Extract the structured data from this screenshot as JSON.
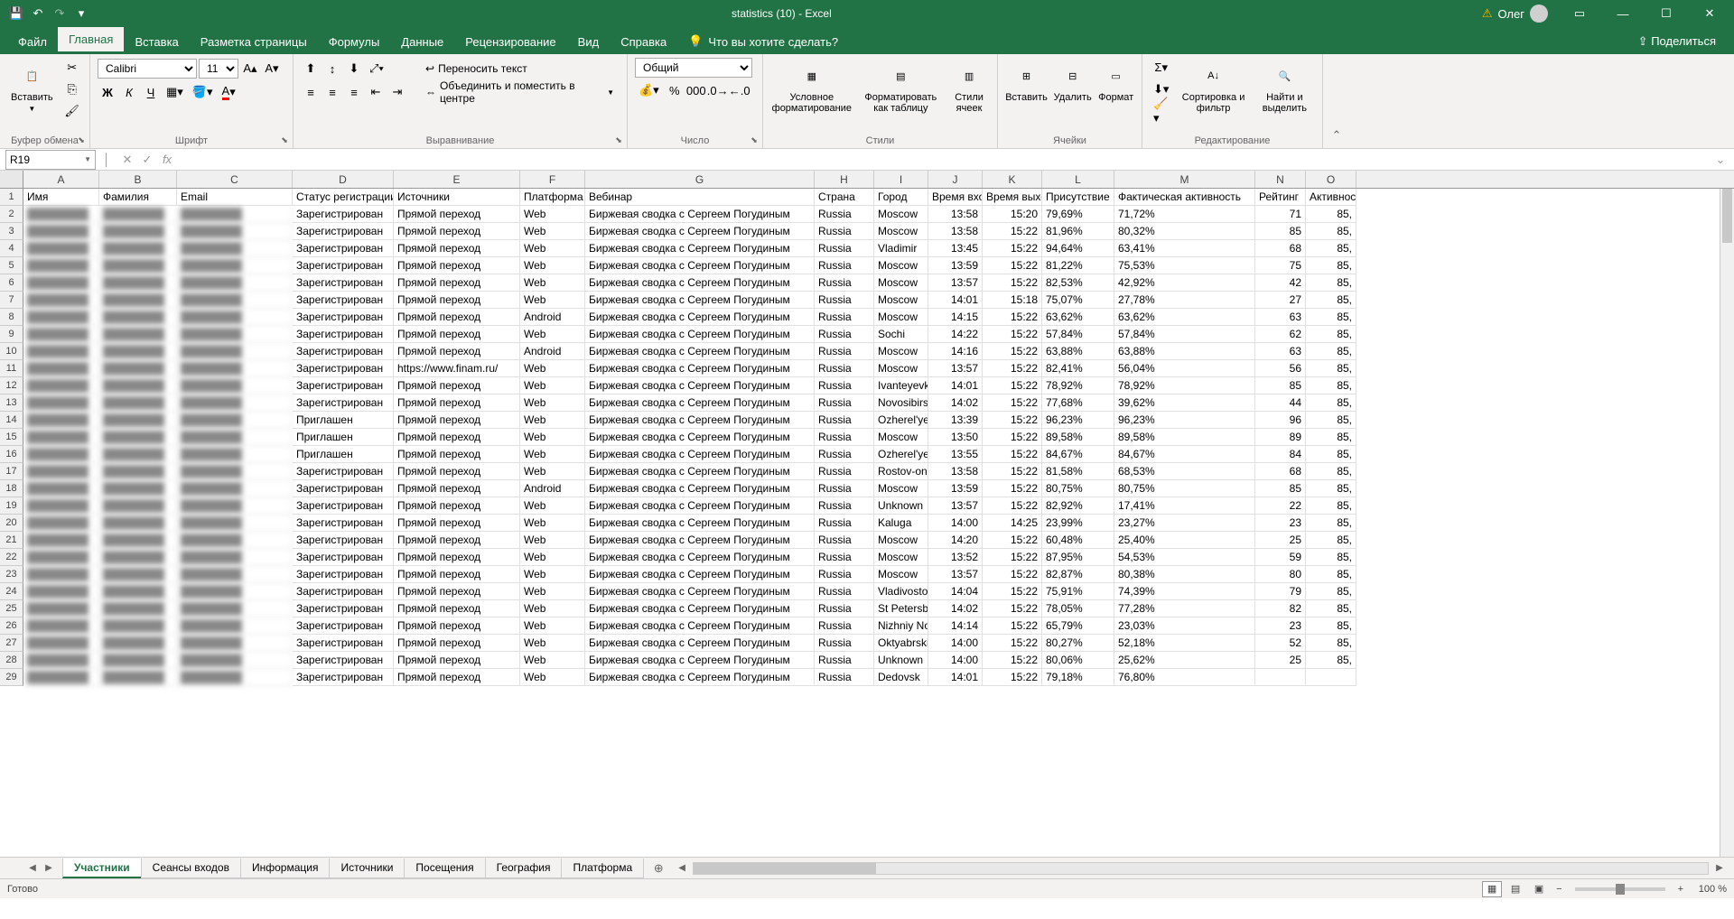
{
  "title": "statistics (10) - Excel",
  "user": {
    "name": "Олег",
    "warning": true
  },
  "menu": {
    "file": "Файл",
    "home": "Главная",
    "insert": "Вставка",
    "pagelayout": "Разметка страницы",
    "formulas": "Формулы",
    "data": "Данные",
    "review": "Рецензирование",
    "view": "Вид",
    "help": "Справка",
    "tellme": "Что вы хотите сделать?",
    "share": "Поделиться"
  },
  "ribbon": {
    "clipboard": {
      "paste": "Вставить",
      "label": "Буфер обмена"
    },
    "font": {
      "name": "Calibri",
      "size": "11",
      "label": "Шрифт"
    },
    "alignment": {
      "wrap": "Переносить текст",
      "merge": "Объединить и поместить в центре",
      "label": "Выравнивание"
    },
    "number": {
      "format": "Общий",
      "label": "Число"
    },
    "styles": {
      "conditional": "Условное форматирование",
      "table": "Форматировать как таблицу",
      "cellstyles": "Стили ячеек",
      "label": "Стили"
    },
    "cells": {
      "insert": "Вставить",
      "delete": "Удалить",
      "format": "Формат",
      "label": "Ячейки"
    },
    "editing": {
      "sort": "Сортировка и фильтр",
      "find": "Найти и выделить",
      "label": "Редактирование"
    }
  },
  "namebox": "R19",
  "columns": [
    "A",
    "B",
    "C",
    "D",
    "E",
    "F",
    "G",
    "H",
    "I",
    "J",
    "K",
    "L",
    "M",
    "N",
    "O"
  ],
  "colClasses": [
    "col-A",
    "col-B",
    "col-C",
    "col-D",
    "col-E",
    "col-F",
    "col-G",
    "col-H",
    "col-I",
    "col-J",
    "col-K",
    "col-L",
    "col-M",
    "col-N",
    "col-O"
  ],
  "headerRow": [
    "Имя",
    "Фамилия",
    "Email",
    "Статус регистрации",
    "Источники",
    "Платформа",
    "Вебинар",
    "Страна",
    "Город",
    "Время входа",
    "Время выхода",
    "Присутствие",
    "Фактическая активность",
    "Рейтинг",
    "Активность"
  ],
  "rows": [
    {
      "d": "Зарегистрирован",
      "e": "Прямой переход",
      "f": "Web",
      "g": "Биржевая сводка с Сергеем Погудиным",
      "h": "Russia",
      "i": "Moscow",
      "j": "13:58",
      "k": "15:20",
      "l": "79,69%",
      "m": "71,72%",
      "n": "71",
      "o": "85,"
    },
    {
      "d": "Зарегистрирован",
      "e": "Прямой переход",
      "f": "Web",
      "g": "Биржевая сводка с Сергеем Погудиным",
      "h": "Russia",
      "i": "Moscow",
      "j": "13:58",
      "k": "15:22",
      "l": "81,96%",
      "m": "80,32%",
      "n": "85",
      "o": "85,"
    },
    {
      "d": "Зарегистрирован",
      "e": "Прямой переход",
      "f": "Web",
      "g": "Биржевая сводка с Сергеем Погудиным",
      "h": "Russia",
      "i": "Vladimir",
      "j": "13:45",
      "k": "15:22",
      "l": "94,64%",
      "m": "63,41%",
      "n": "68",
      "o": "85,"
    },
    {
      "d": "Зарегистрирован",
      "e": "Прямой переход",
      "f": "Web",
      "g": "Биржевая сводка с Сергеем Погудиным",
      "h": "Russia",
      "i": "Moscow",
      "j": "13:59",
      "k": "15:22",
      "l": "81,22%",
      "m": "75,53%",
      "n": "75",
      "o": "85,"
    },
    {
      "d": "Зарегистрирован",
      "e": "Прямой переход",
      "f": "Web",
      "g": "Биржевая сводка с Сергеем Погудиным",
      "h": "Russia",
      "i": "Moscow",
      "j": "13:57",
      "k": "15:22",
      "l": "82,53%",
      "m": "42,92%",
      "n": "42",
      "o": "85,"
    },
    {
      "d": "Зарегистрирован",
      "e": "Прямой переход",
      "f": "Web",
      "g": "Биржевая сводка с Сергеем Погудиным",
      "h": "Russia",
      "i": "Moscow",
      "j": "14:01",
      "k": "15:18",
      "l": "75,07%",
      "m": "27,78%",
      "n": "27",
      "o": "85,"
    },
    {
      "d": "Зарегистрирован",
      "e": "Прямой переход",
      "f": "Android",
      "g": "Биржевая сводка с Сергеем Погудиным",
      "h": "Russia",
      "i": "Moscow",
      "j": "14:15",
      "k": "15:22",
      "l": "63,62%",
      "m": "63,62%",
      "n": "63",
      "o": "85,"
    },
    {
      "d": "Зарегистрирован",
      "e": "Прямой переход",
      "f": "Web",
      "g": "Биржевая сводка с Сергеем Погудиным",
      "h": "Russia",
      "i": "Sochi",
      "j": "14:22",
      "k": "15:22",
      "l": "57,84%",
      "m": "57,84%",
      "n": "62",
      "o": "85,"
    },
    {
      "d": "Зарегистрирован",
      "e": "Прямой переход",
      "f": "Android",
      "g": "Биржевая сводка с Сергеем Погудиным",
      "h": "Russia",
      "i": "Moscow",
      "j": "14:16",
      "k": "15:22",
      "l": "63,88%",
      "m": "63,88%",
      "n": "63",
      "o": "85,"
    },
    {
      "d": "Зарегистрирован",
      "e": "https://www.finam.ru/",
      "f": "Web",
      "g": "Биржевая сводка с Сергеем Погудиным",
      "h": "Russia",
      "i": "Moscow",
      "j": "13:57",
      "k": "15:22",
      "l": "82,41%",
      "m": "56,04%",
      "n": "56",
      "o": "85,"
    },
    {
      "d": "Зарегистрирован",
      "e": "Прямой переход",
      "f": "Web",
      "g": "Биржевая сводка с Сергеем Погудиным",
      "h": "Russia",
      "i": "Ivanteyevka",
      "j": "14:01",
      "k": "15:22",
      "l": "78,92%",
      "m": "78,92%",
      "n": "85",
      "o": "85,"
    },
    {
      "d": "Зарегистрирован",
      "e": "Прямой переход",
      "f": "Web",
      "g": "Биржевая сводка с Сергеем Погудиным",
      "h": "Russia",
      "i": "Novosibirsk",
      "j": "14:02",
      "k": "15:22",
      "l": "77,68%",
      "m": "39,62%",
      "n": "44",
      "o": "85,"
    },
    {
      "d": "Приглашен",
      "e": "Прямой переход",
      "f": "Web",
      "g": "Биржевая сводка с Сергеем Погудиным",
      "h": "Russia",
      "i": "Ozherel'ye",
      "j": "13:39",
      "k": "15:22",
      "l": "96,23%",
      "m": "96,23%",
      "n": "96",
      "o": "85,"
    },
    {
      "d": "Приглашен",
      "e": "Прямой переход",
      "f": "Web",
      "g": "Биржевая сводка с Сергеем Погудиным",
      "h": "Russia",
      "i": "Moscow",
      "j": "13:50",
      "k": "15:22",
      "l": "89,58%",
      "m": "89,58%",
      "n": "89",
      "o": "85,"
    },
    {
      "d": "Приглашен",
      "e": "Прямой переход",
      "f": "Web",
      "g": "Биржевая сводка с Сергеем Погудиным",
      "h": "Russia",
      "i": "Ozherel'ye",
      "j": "13:55",
      "k": "15:22",
      "l": "84,67%",
      "m": "84,67%",
      "n": "84",
      "o": "85,"
    },
    {
      "d": "Зарегистрирован",
      "e": "Прямой переход",
      "f": "Web",
      "g": "Биржевая сводка с Сергеем Погудиным",
      "h": "Russia",
      "i": "Rostov-on",
      "j": "13:58",
      "k": "15:22",
      "l": "81,58%",
      "m": "68,53%",
      "n": "68",
      "o": "85,"
    },
    {
      "d": "Зарегистрирован",
      "e": "Прямой переход",
      "f": "Android",
      "g": "Биржевая сводка с Сергеем Погудиным",
      "h": "Russia",
      "i": "Moscow",
      "j": "13:59",
      "k": "15:22",
      "l": "80,75%",
      "m": "80,75%",
      "n": "85",
      "o": "85,"
    },
    {
      "d": "Зарегистрирован",
      "e": "Прямой переход",
      "f": "Web",
      "g": "Биржевая сводка с Сергеем Погудиным",
      "h": "Russia",
      "i": "Unknown",
      "j": "13:57",
      "k": "15:22",
      "l": "82,92%",
      "m": "17,41%",
      "n": "22",
      "o": "85,"
    },
    {
      "d": "Зарегистрирован",
      "e": "Прямой переход",
      "f": "Web",
      "g": "Биржевая сводка с Сергеем Погудиным",
      "h": "Russia",
      "i": "Kaluga",
      "j": "14:00",
      "k": "14:25",
      "l": "23,99%",
      "m": "23,27%",
      "n": "23",
      "o": "85,"
    },
    {
      "d": "Зарегистрирован",
      "e": "Прямой переход",
      "f": "Web",
      "g": "Биржевая сводка с Сергеем Погудиным",
      "h": "Russia",
      "i": "Moscow",
      "j": "14:20",
      "k": "15:22",
      "l": "60,48%",
      "m": "25,40%",
      "n": "25",
      "o": "85,"
    },
    {
      "d": "Зарегистрирован",
      "e": "Прямой переход",
      "f": "Web",
      "g": "Биржевая сводка с Сергеем Погудиным",
      "h": "Russia",
      "i": "Moscow",
      "j": "13:52",
      "k": "15:22",
      "l": "87,95%",
      "m": "54,53%",
      "n": "59",
      "o": "85,"
    },
    {
      "d": "Зарегистрирован",
      "e": "Прямой переход",
      "f": "Web",
      "g": "Биржевая сводка с Сергеем Погудиным",
      "h": "Russia",
      "i": "Moscow",
      "j": "13:57",
      "k": "15:22",
      "l": "82,87%",
      "m": "80,38%",
      "n": "80",
      "o": "85,"
    },
    {
      "d": "Зарегистрирован",
      "e": "Прямой переход",
      "f": "Web",
      "g": "Биржевая сводка с Сергеем Погудиным",
      "h": "Russia",
      "i": "Vladivostok",
      "j": "14:04",
      "k": "15:22",
      "l": "75,91%",
      "m": "74,39%",
      "n": "79",
      "o": "85,"
    },
    {
      "d": "Зарегистрирован",
      "e": "Прямой переход",
      "f": "Web",
      "g": "Биржевая сводка с Сергеем Погудиным",
      "h": "Russia",
      "i": "St Petersburg",
      "j": "14:02",
      "k": "15:22",
      "l": "78,05%",
      "m": "77,28%",
      "n": "82",
      "o": "85,"
    },
    {
      "d": "Зарегистрирован",
      "e": "Прямой переход",
      "f": "Web",
      "g": "Биржевая сводка с Сергеем Погудиным",
      "h": "Russia",
      "i": "Nizhniy Novgorod",
      "j": "14:14",
      "k": "15:22",
      "l": "65,79%",
      "m": "23,03%",
      "n": "23",
      "o": "85,"
    },
    {
      "d": "Зарегистрирован",
      "e": "Прямой переход",
      "f": "Web",
      "g": "Биржевая сводка с Сергеем Погудиным",
      "h": "Russia",
      "i": "Oktyabrskiy",
      "j": "14:00",
      "k": "15:22",
      "l": "80,27%",
      "m": "52,18%",
      "n": "52",
      "o": "85,"
    },
    {
      "d": "Зарегистрирован",
      "e": "Прямой переход",
      "f": "Web",
      "g": "Биржевая сводка с Сергеем Погудиным",
      "h": "Russia",
      "i": "Unknown",
      "j": "14:00",
      "k": "15:22",
      "l": "80,06%",
      "m": "25,62%",
      "n": "25",
      "o": "85,"
    },
    {
      "d": "Зарегистрирован",
      "e": "Прямой переход",
      "f": "Web",
      "g": "Биржевая сводка с Сергеем Погудиным",
      "h": "Russia",
      "i": "Dedovsk",
      "j": "14:01",
      "k": "15:22",
      "l": "79,18%",
      "m": "76,80%",
      "n": "",
      "o": ""
    }
  ],
  "sheets": [
    "Участники",
    "Сеансы входов",
    "Информация",
    "Источники",
    "Посещения",
    "География",
    "Платформа"
  ],
  "activeSheet": 0,
  "status": "Готово",
  "zoom": "100 %"
}
